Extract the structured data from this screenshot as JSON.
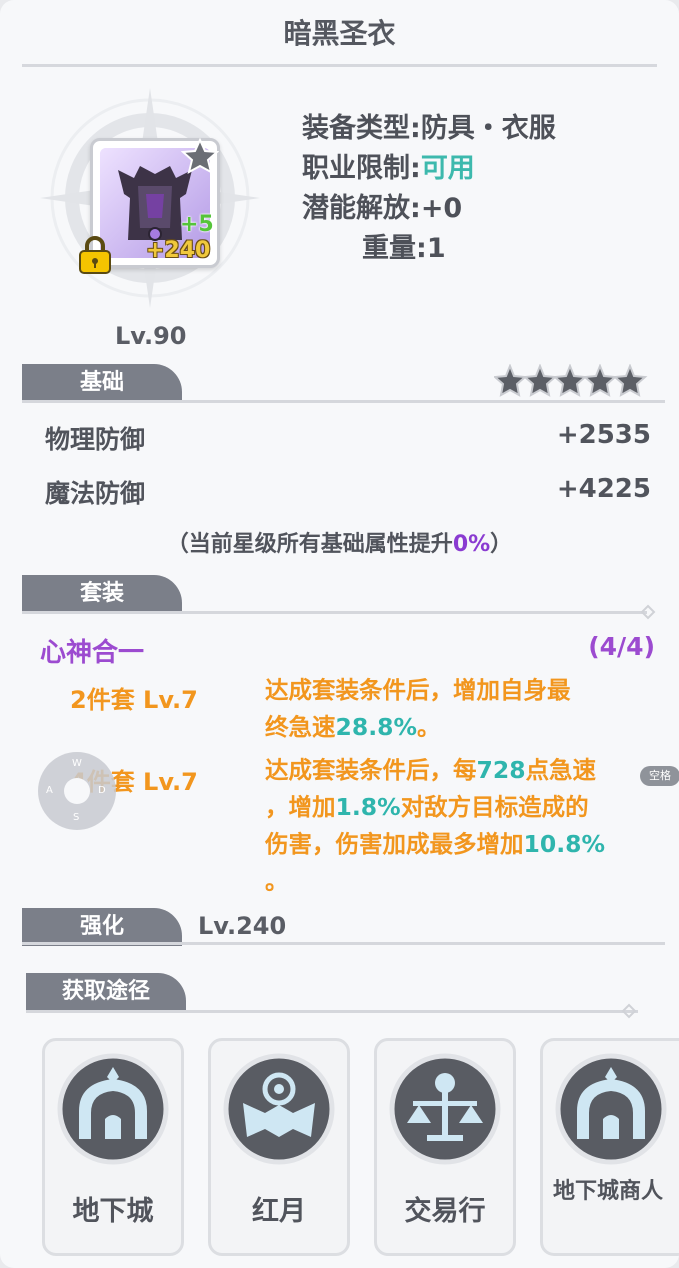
{
  "title": "暗黑圣衣",
  "item": {
    "enhance_plus": "+5",
    "strengthen_plus": "+240",
    "level": "Lv.90"
  },
  "info": {
    "type_label": "装备类型:",
    "type_value": "防具・衣服",
    "job_label": "职业限制:",
    "job_value": "可用",
    "potential_label": "潜能解放:",
    "potential_value": "+0",
    "weight_label": "重量:",
    "weight_value": "1"
  },
  "basic": {
    "tab": "基础",
    "stars_filled": 0,
    "stars_total": 5,
    "stats": [
      {
        "label": "物理防御",
        "value": "+2535"
      },
      {
        "label": "魔法防御",
        "value": "+4225"
      }
    ],
    "note_prefix": "（当前星级所有基础属性提升",
    "note_value": "0%",
    "note_suffix": "）"
  },
  "set": {
    "tab": "套装",
    "name": "心神合一",
    "count": "(4/4)",
    "tiers": [
      {
        "label": "2件套 Lv.7",
        "line1": "达成套装条件后，增加自身最",
        "line2_a": "终急速",
        "line2_b": "28.8%",
        "line2_c": "。"
      },
      {
        "label": "4件套 Lv.7",
        "line1_a": "达成套装条件后，每",
        "line1_b": "728",
        "line1_c": "点急速",
        "line2_a": "，增加",
        "line2_b": "1.8%",
        "line2_c": "对敌方目标造成的",
        "line3_a": "伤害，伤害加成最多增加",
        "line3_b": "10.8%",
        "line4": "。"
      }
    ]
  },
  "enhance": {
    "tab": "强化",
    "level": "Lv.240"
  },
  "source": {
    "tab": "获取途径",
    "items": [
      {
        "label": "地下城",
        "icon": "dungeon-icon"
      },
      {
        "label": "红月",
        "icon": "red-moon-icon"
      },
      {
        "label": "交易行",
        "icon": "trade-scale-icon"
      },
      {
        "label": "地下城商人",
        "icon": "dungeon-merchant-icon"
      }
    ]
  },
  "overlay": {
    "dpad_keys": [
      "W",
      "A",
      "S",
      "D"
    ],
    "space_key": "空格"
  },
  "colors": {
    "teal": "#3db9ad",
    "purple": "#9c4bd0",
    "orange": "#f2961e",
    "tab_gray": "#7b7f89"
  }
}
